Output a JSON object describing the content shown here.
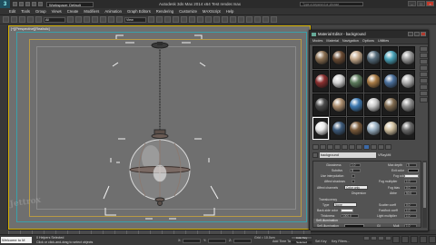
{
  "titlebar": {
    "logo": "3",
    "workspace": "Workspace: Default",
    "app_title": "Autodesk 3ds Max 2014 x64    Test render.max",
    "search_placeholder": "Type a keyword or phrase"
  },
  "menubar": [
    "Edit",
    "Tools",
    "Group",
    "Views",
    "Create",
    "Modifiers",
    "Animation",
    "Graph Editors",
    "Rendering",
    "Customize",
    "MAXScript",
    "Help"
  ],
  "toolbar": {
    "filter": "All",
    "view": "View"
  },
  "viewport": {
    "label": "[+][Perspective][Realistic]",
    "watermark": "Jettrox"
  },
  "material_editor": {
    "title": "Material Editor - background",
    "menu": [
      "Modes",
      "Material",
      "Navigation",
      "Options",
      "Utilities"
    ],
    "slot_colors": [
      "#8a6f52",
      "#6a4b33",
      "#c4a88a",
      "#556b7a",
      "#4aa2b8",
      "#9a9a9a",
      "#8a2f2f",
      "#d2d2d2",
      "#5b7a5b",
      "#a77a44",
      "#4a6f9b",
      "#b0b0b0",
      "#4a4a4a",
      "#aa8c6d",
      "#3d78b0",
      "#c8c8c8",
      "#7f6a4f",
      "#8f8f8f",
      "#e8e8e8",
      "#3d5a7a",
      "#7a5a3a",
      "#9ab0c2",
      "#d0c0a0",
      "#6a6a6a"
    ],
    "selected_slot": 18,
    "material_name": "background",
    "material_type": "VRayMtl",
    "params": {
      "glossiness_lbl": "Glossiness",
      "glossiness_val": "1.0",
      "subdivs_lbl": "Subdivs",
      "subdivs_val": "8",
      "use_interp_lbl": "Use interpolation",
      "affect_shadows_lbl": "Affect shadows",
      "affect_channels_lbl": "Affect channels",
      "affect_channels_val": "Color only",
      "max_depth_lbl": "Max depth",
      "max_depth_val": "5",
      "exit_color_lbl": "Exit color",
      "fog_color_lbl": "Fog color",
      "fog_mult_lbl": "Fog multiplier",
      "fog_mult_val": "1.0",
      "fog_bias_lbl": "Fog bias",
      "fog_bias_val": "0.0",
      "dispersion_lbl": "Dispersion",
      "abbe_lbl": "Abbe",
      "abbe_val": "50.0",
      "translucency_lbl": "Translucency",
      "type_lbl": "Type",
      "type_val": "None",
      "scatter_lbl": "Scatter coeff",
      "scatter_val": "0.0",
      "back_side_lbl": "Back-side color",
      "fwd_bck_lbl": "Fwd/bck coeff",
      "fwd_bck_val": "1.0",
      "thickness_lbl": "Thickness",
      "thickness_val": "1000.0",
      "light_mult_lbl": "Light multiplier",
      "light_mult_val": "1.0",
      "self_illum_roll": "Self-illumination",
      "self_illum_lbl": "Self-illumination",
      "gi_lbl": "GI",
      "mult_lbl": "Mult",
      "mult_val": "1.0"
    }
  },
  "status": {
    "welcome": "Welcome to M",
    "line1": "0 Helpers Selected",
    "line2": "Click or click-and-drag to select objects",
    "x_lbl": "X:",
    "y_lbl": "Y:",
    "z_lbl": "Z:",
    "grid": "Grid = 10.0cm",
    "add_time_tag": "Add Time Tag",
    "auto_key": "Auto Key",
    "selected": "Selected",
    "set_key": "Set Key",
    "key_filters": "Key Filters..."
  }
}
